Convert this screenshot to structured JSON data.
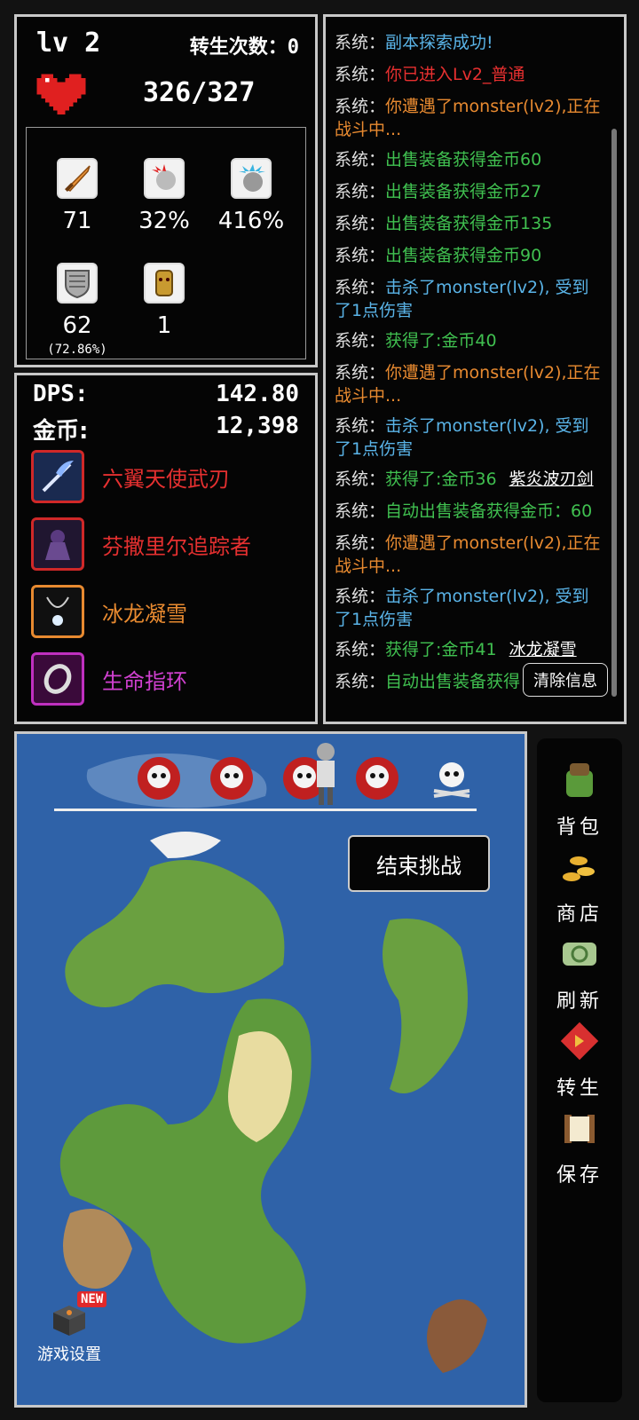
{
  "stats": {
    "level": "lv 2",
    "rebirth": "转生次数：0",
    "hp": "326/327",
    "attack": "71",
    "crit_rate": "32%",
    "crit_damage": "416%",
    "defense": "62",
    "defense_pct": "(72.86%)",
    "luck": "1"
  },
  "equip": {
    "dps_label": "DPS:",
    "dps_value": "142.80",
    "gold_label": "金币:",
    "gold_value": "12,398",
    "items": [
      {
        "name": "六翼天使武刃",
        "color": "#e53030",
        "frame": "#d02828",
        "icon": "wing-blade-icon"
      },
      {
        "name": "芬撒里尔追踪者",
        "color": "#e53030",
        "frame": "#d02828",
        "icon": "dark-armor-icon"
      },
      {
        "name": "冰龙凝雪",
        "color": "#e88a30",
        "frame": "#e88a30",
        "icon": "amulet-icon"
      },
      {
        "name": "生命指环",
        "color": "#d040d0",
        "frame": "#c030c0",
        "icon": "ring-icon"
      }
    ]
  },
  "log": {
    "prefix": "系统：",
    "lines": [
      {
        "text": "副本探索成功!",
        "color": "#5ab4e8",
        "extra": ""
      },
      {
        "text": "你已进入Lv2_普通",
        "color": "#e83030",
        "extra": ""
      },
      {
        "text": "你遭遇了monster(lv2),正在战斗中...",
        "color": "#e88a30",
        "extra": ""
      },
      {
        "text": "出售装备获得金币60",
        "color": "#40c050",
        "extra": ""
      },
      {
        "text": "出售装备获得金币27",
        "color": "#40c050",
        "extra": ""
      },
      {
        "text": "出售装备获得金币135",
        "color": "#40c050",
        "extra": ""
      },
      {
        "text": "出售装备获得金币90",
        "color": "#40c050",
        "extra": ""
      },
      {
        "text": "击杀了monster(lv2), 受到了1点伤害",
        "color": "#5ab4e8",
        "extra": ""
      },
      {
        "text": "获得了:金币40",
        "color": "#40c050",
        "extra": ""
      },
      {
        "text": "你遭遇了monster(lv2),正在战斗中...",
        "color": "#e88a30",
        "extra": ""
      },
      {
        "text": "击杀了monster(lv2), 受到了1点伤害",
        "color": "#5ab4e8",
        "extra": ""
      },
      {
        "text": "获得了:金币36",
        "color": "#40c050",
        "extra": "紫炎波刃剑"
      },
      {
        "text": "自动出售装备获得金币：60",
        "color": "#40c050",
        "extra": ""
      },
      {
        "text": "你遭遇了monster(lv2),正在战斗中...",
        "color": "#e88a30",
        "extra": ""
      },
      {
        "text": "击杀了monster(lv2), 受到了1点伤害",
        "color": "#5ab4e8",
        "extra": ""
      },
      {
        "text": "获得了:金币41",
        "color": "#40c050",
        "extra": "冰龙凝雪"
      },
      {
        "text": "自动出售装备获得",
        "color": "#40c050",
        "extra": ""
      }
    ],
    "clear_label": "清除信息"
  },
  "map": {
    "end_challenge": "结束挑战",
    "settings_label": "游戏设置",
    "new_badge": "NEW"
  },
  "menu": [
    {
      "label": "背包",
      "icon": "backpack-icon"
    },
    {
      "label": "商店",
      "icon": "coins-icon"
    },
    {
      "label": "刷新",
      "icon": "scroll-refresh-icon"
    },
    {
      "label": "转生",
      "icon": "rebirth-icon"
    },
    {
      "label": "保存",
      "icon": "save-scroll-icon"
    }
  ]
}
